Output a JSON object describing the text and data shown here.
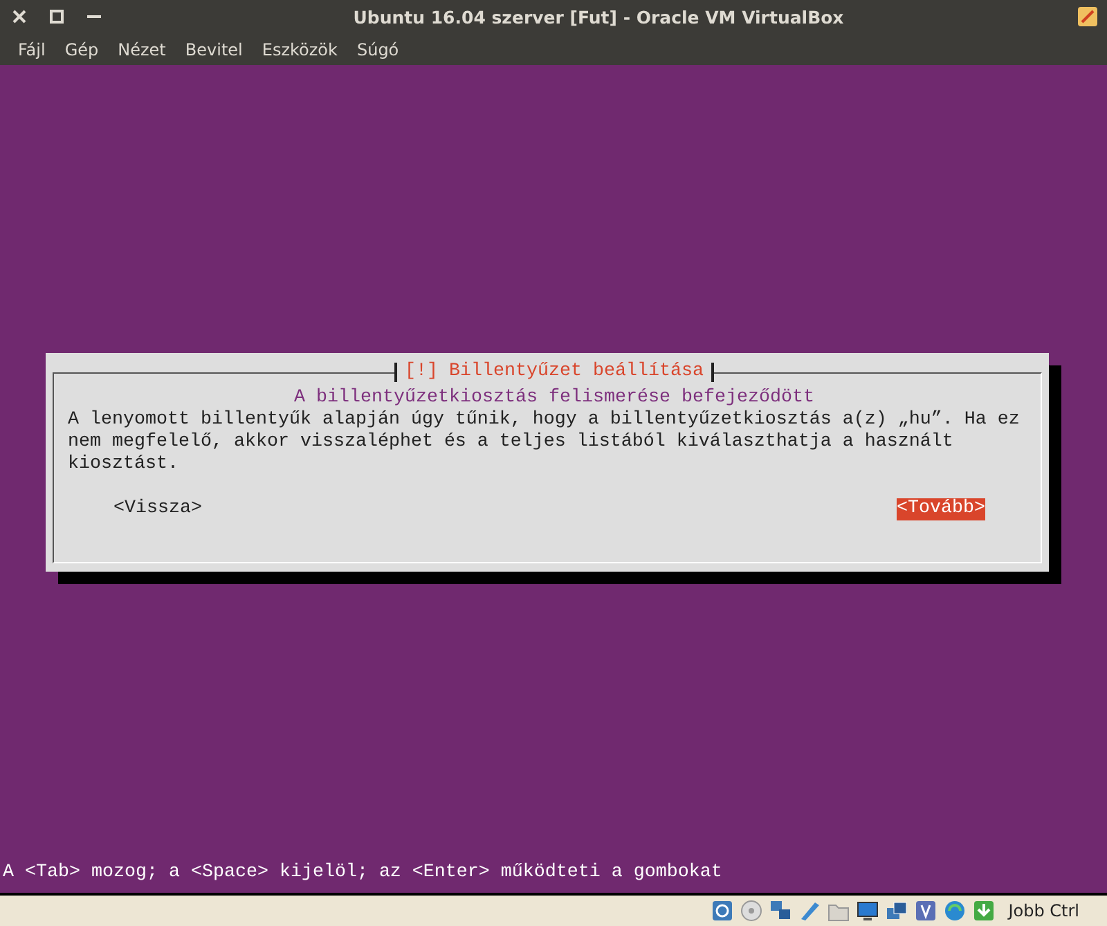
{
  "window": {
    "title": "Ubuntu 16.04 szerver [Fut] - Oracle VM VirtualBox"
  },
  "menu": [
    "Fájl",
    "Gép",
    "Nézet",
    "Bevitel",
    "Eszközök",
    "Súgó"
  ],
  "dialog": {
    "title": "[!] Billentyűzet beállítása",
    "heading": "A billentyűzetkiosztás felismerése befejeződött",
    "body": [
      "A lenyomott billentyűk alapján úgy tűnik, hogy a billentyűzetkiosztás a(z) „hu”. Ha ez",
      "nem megfelelő, akkor visszaléphet és a teljes listából kiválaszthatja a használt",
      "kiosztást."
    ],
    "buttons": [
      {
        "label": "<Vissza>",
        "selected": false
      },
      {
        "label": "<Tovább>",
        "selected": true
      }
    ]
  },
  "help_line": "A <Tab> mozog; a <Space> kijelöl; az <Enter> működteti a gombokat",
  "status_bar": {
    "host_key": "Jobb Ctrl"
  }
}
